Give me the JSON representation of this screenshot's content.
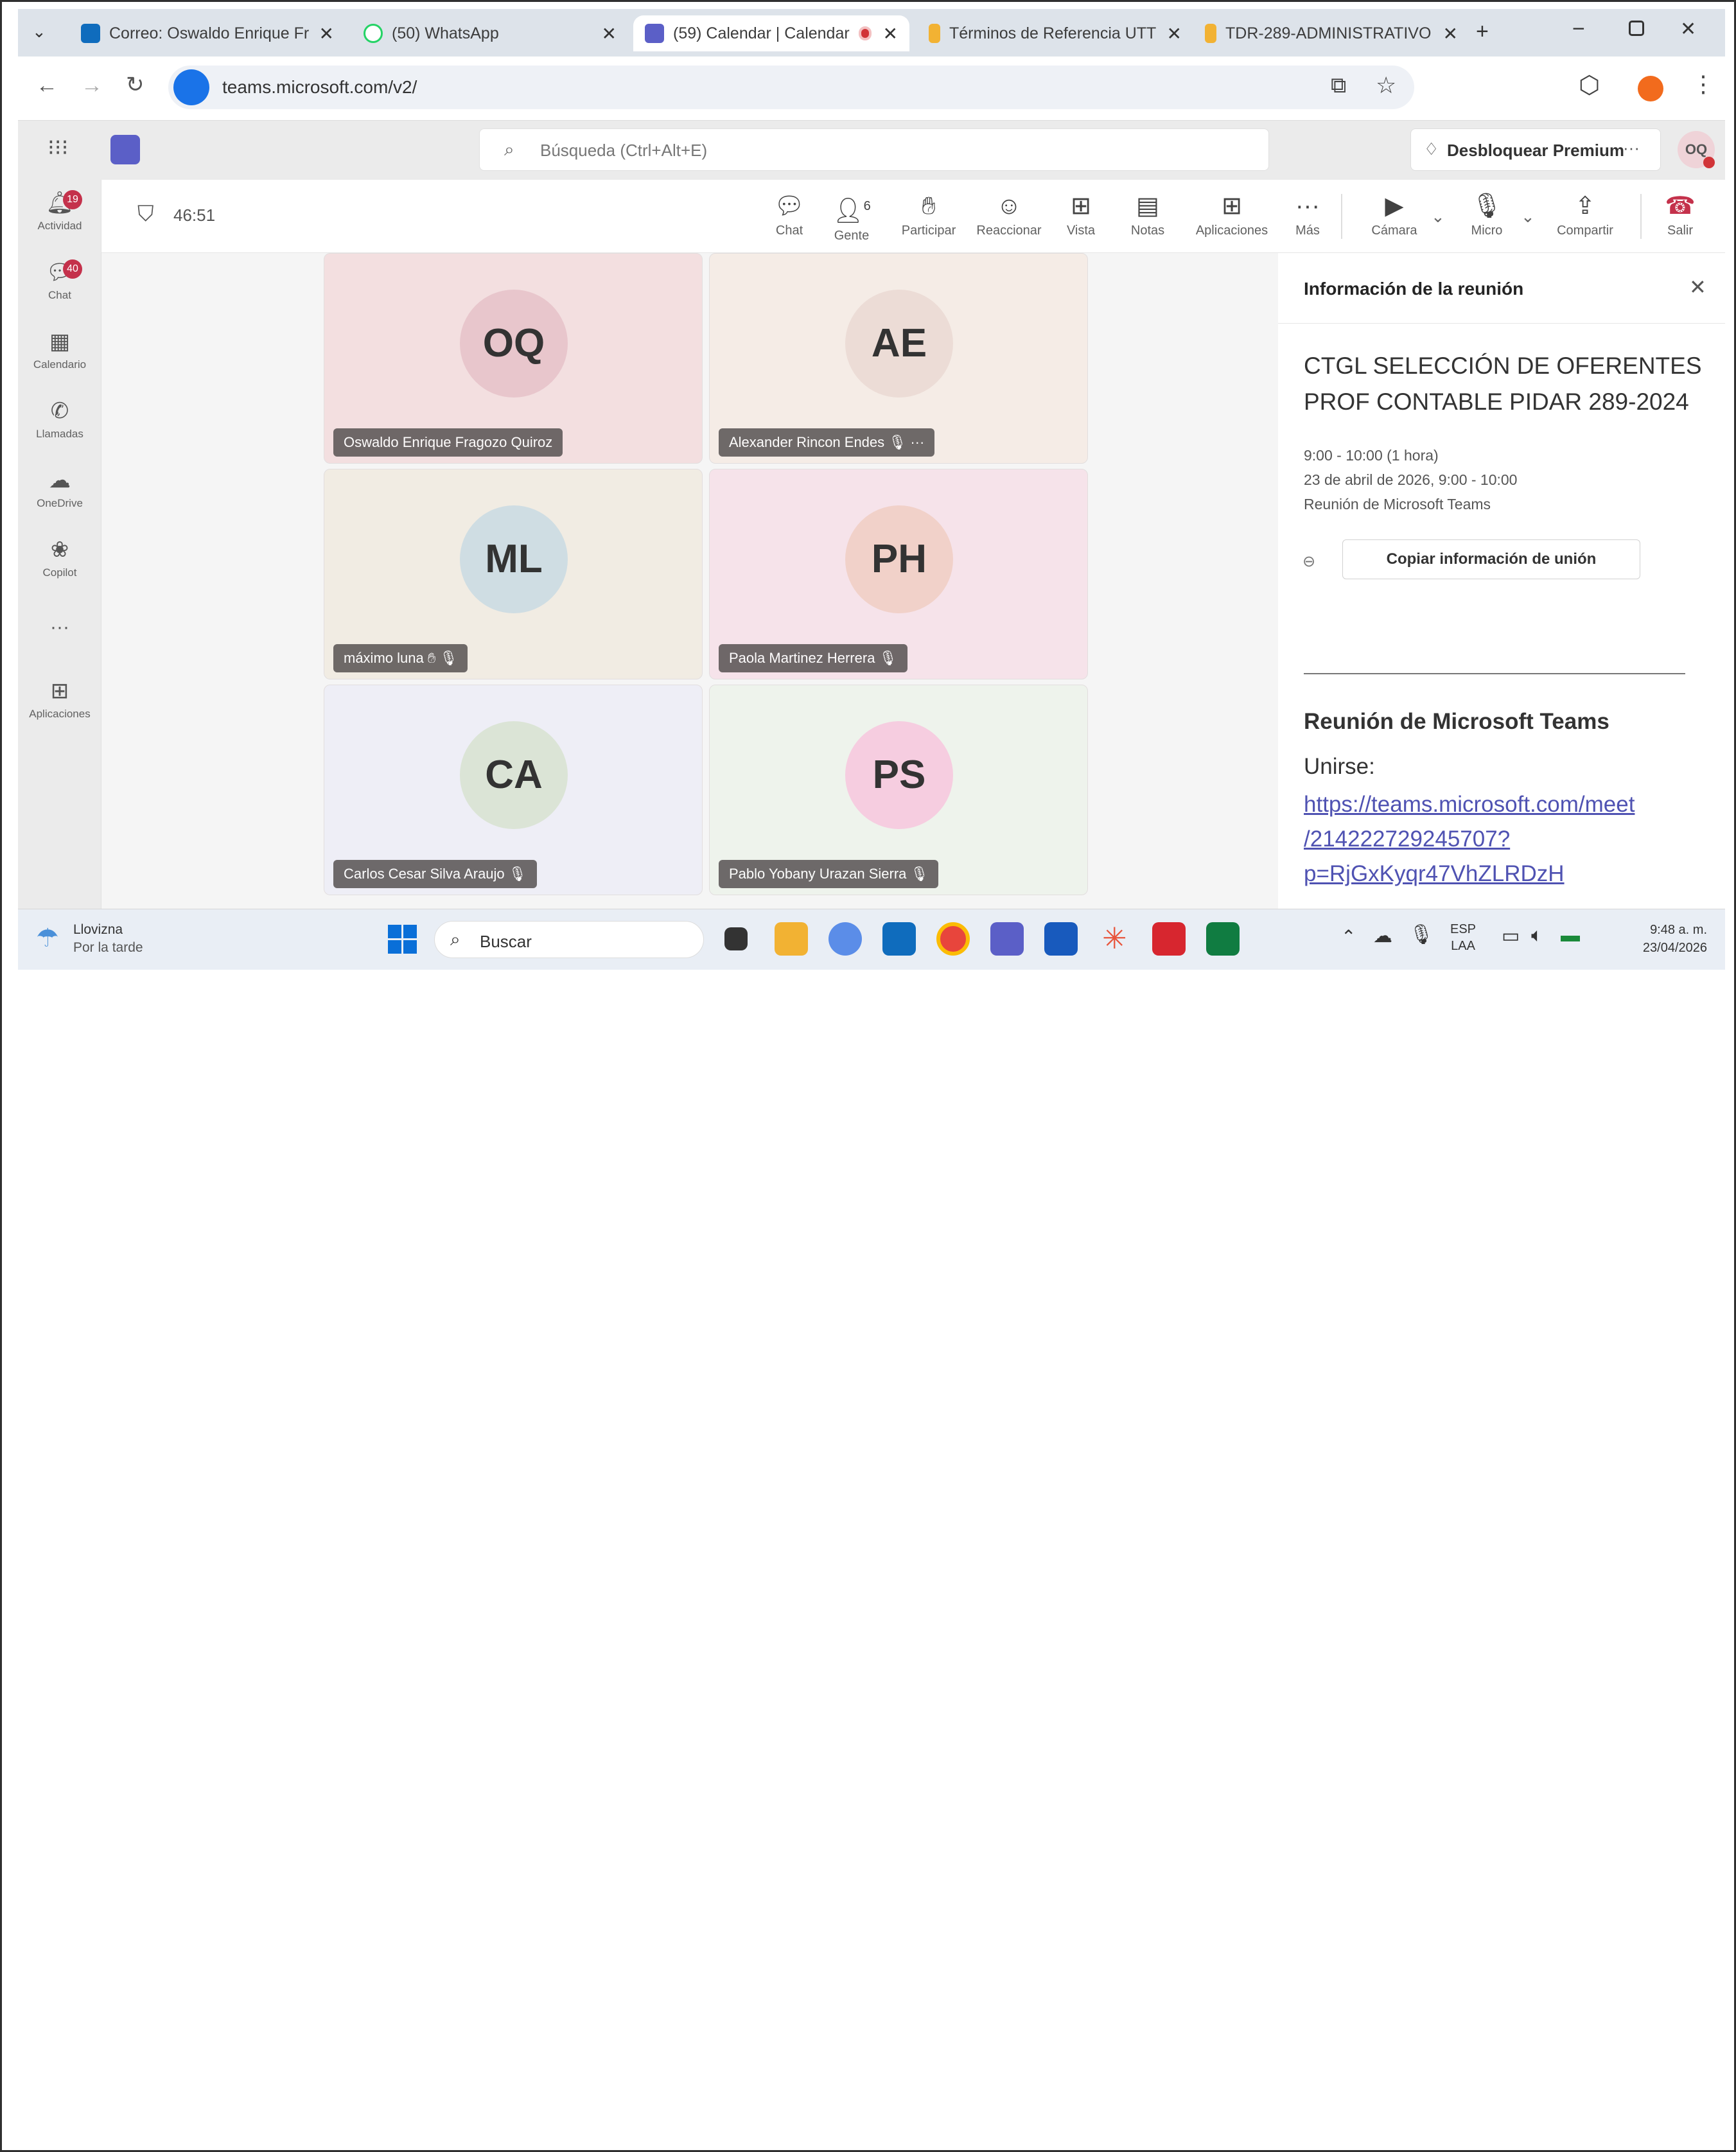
{
  "browser": {
    "tabs": [
      {
        "label": "Correo: Oswaldo Enrique Fr",
        "color": "#0f6cbd"
      },
      {
        "label": "(50) WhatsApp",
        "color": "#25d366"
      },
      {
        "label": "(59) Calendar | Calendar",
        "color": "#5b5fc7"
      },
      {
        "label": "Términos de Referencia UTT",
        "color": "#f2b233"
      },
      {
        "label": "TDR-289-ADMINISTRATIVO",
        "color": "#f2b233"
      }
    ],
    "url": "teams.microsoft.com/v2/"
  },
  "teams": {
    "search_placeholder": "Búsqueda (Ctrl+Alt+E)",
    "premium_label": "Desbloquear Premium",
    "premium_more": "···",
    "user_initials": "OQ"
  },
  "rail": [
    {
      "label": "Actividad",
      "icon": "bell-icon",
      "badge": "19"
    },
    {
      "label": "Chat",
      "icon": "chat-icon",
      "badge": "40"
    },
    {
      "label": "Calendario",
      "icon": "calendar-icon",
      "badge": ""
    },
    {
      "label": "Llamadas",
      "icon": "phone-icon",
      "badge": ""
    },
    {
      "label": "OneDrive",
      "icon": "cloud-icon",
      "badge": ""
    },
    {
      "label": "Copilot",
      "icon": "copilot-icon",
      "badge": ""
    },
    {
      "label": "···",
      "icon": "more-icon",
      "badge": ""
    },
    {
      "label": "Aplicaciones",
      "icon": "plus-square-icon",
      "badge": ""
    }
  ],
  "meeting": {
    "timer": "46:51",
    "people_count": "6",
    "toolbar": [
      {
        "label": "Chat",
        "icon": "chat-bubble-icon"
      },
      {
        "label": "Gente",
        "icon": "people-icon"
      },
      {
        "label": "Participar",
        "icon": "raise-hand-icon"
      },
      {
        "label": "Reaccionar",
        "icon": "smile-icon"
      },
      {
        "label": "Vista",
        "icon": "grid-view-icon"
      },
      {
        "label": "Notas",
        "icon": "notes-icon"
      },
      {
        "label": "Aplicaciones",
        "icon": "plus-square-icon"
      },
      {
        "label": "Más",
        "icon": "more-icon"
      },
      {
        "label": "Cámara",
        "icon": "camera-off-icon"
      },
      {
        "label": "Micro",
        "icon": "mic-icon"
      },
      {
        "label": "Compartir",
        "icon": "share-screen-icon"
      },
      {
        "label": "Salir",
        "icon": "hang-up-icon"
      }
    ],
    "participants": [
      {
        "initials": "OQ",
        "name": "Oswaldo Enrique Fragozo Quiroz",
        "bg": "#f3dfe0",
        "avatar": "#e8c6cc",
        "muted": false
      },
      {
        "initials": "AE",
        "name": "Alexander Rincon Endes",
        "bg": "#f5ece6",
        "avatar": "#ecdcd6",
        "muted": true
      },
      {
        "initials": "ML",
        "name": "máximo luna",
        "bg": "#f1ece3",
        "avatar": "#cfdde3",
        "muted": true
      },
      {
        "initials": "PH",
        "name": "Paola Martinez Herrera",
        "bg": "#f6e3ea",
        "avatar": "#f1d1c9",
        "muted": true
      },
      {
        "initials": "CA",
        "name": "Carlos Cesar Silva Araujo",
        "bg": "#eeeef6",
        "avatar": "#dbe4d6",
        "muted": true
      },
      {
        "initials": "PS",
        "name": "Pablo Yobany Urazan Sierra",
        "bg": "#eef3ec",
        "avatar": "#f6cde0",
        "muted": true
      }
    ]
  },
  "info_panel": {
    "header": "Información de la reunión",
    "title_line1": "CTGL SELECCIÓN DE OFERENTES",
    "title_line2": "PROF CONTABLE PIDAR 289-2024",
    "time": "9:00 - 10:00 (1 hora)",
    "date": "23 de abril de 2026, 9:00 - 10:00",
    "type": "Reunión de Microsoft Teams",
    "copy_button": "Copiar información de unión",
    "section_title": "Reunión de Microsoft Teams",
    "join_label": "Unirse:",
    "link_line1": "https://teams.microsoft.com/meet",
    "link_line2": "/214222729245707?",
    "link_line3": "p=RjGxKyqr47VhZLRDzH"
  },
  "taskbar": {
    "weather_title": "Llovizna",
    "weather_sub": "Por la tarde",
    "search": "Buscar",
    "lang_top": "ESP",
    "lang_bottom": "LAA",
    "time": "9:48 a. m.",
    "date": "23/04/2026"
  }
}
